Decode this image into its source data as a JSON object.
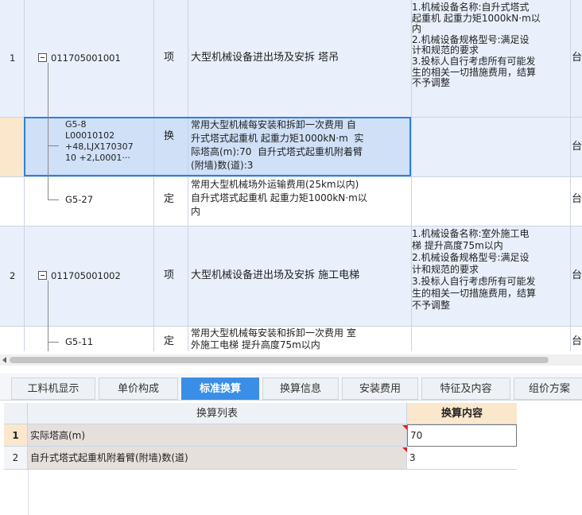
{
  "upper_table": {
    "rows": [
      {
        "index": "1",
        "code": "011705001001",
        "type": "项",
        "name": "大型机械设备进出场及安拆 塔吊",
        "feature": "1.机械设备名称:自升式塔式\n起重机 起重力矩1000kN·m以\n内\n2.机械设备规格型号:满足设\n计和规范的要求\n3.投标人自行考虑所有可能发\n生的相关一切措施费用，结算\n不予调整",
        "unit": "台"
      },
      {
        "index": "",
        "code": "G5-8\nL00010102\n+48,LJX170307\n10 +2,L0001···",
        "type": "换",
        "name": "常用大型机械每安装和拆卸一次费用 自\n升式塔式起重机 起重力矩1000kN·m  实\n际塔高(m):70  自升式塔式起重机附着臂\n(附墙)数(道):3",
        "feature": "",
        "unit": "台"
      },
      {
        "index": "",
        "code": "G5-27",
        "type": "定",
        "name": "常用大型机械场外运输费用(25km以内)\n自升式塔式起重机 起重力矩1000kN·m以\n内",
        "feature": "",
        "unit": "台"
      },
      {
        "index": "2",
        "code": "011705001002",
        "type": "项",
        "name": "大型机械设备进出场及安拆 施工电梯",
        "feature": "1.机械设备名称:室外施工电\n梯 提升高度75m以内\n2.机械设备规格型号:满足设\n计和规范的要求\n3.投标人自行考虑所有可能发\n生的相关一切措施费用，结算\n不予调整",
        "unit": "台"
      },
      {
        "index": "",
        "code": "G5-11",
        "type": "定",
        "name": "常用大型机械每安装和拆卸一次费用 室\n外施工电梯 提升高度75m以内",
        "feature": "",
        "unit": "台"
      }
    ]
  },
  "tabs": [
    {
      "label": "工料机显示",
      "active": false
    },
    {
      "label": "单价构成",
      "active": false
    },
    {
      "label": "标准换算",
      "active": true
    },
    {
      "label": "换算信息",
      "active": false
    },
    {
      "label": "安装费用",
      "active": false
    },
    {
      "label": "特征及内容",
      "active": false
    },
    {
      "label": "组价方案",
      "active": false
    }
  ],
  "lower_table": {
    "headers": {
      "list": "换算列表",
      "content": "换算内容"
    },
    "rows": [
      {
        "index": "1",
        "name": "实际塔高(m)",
        "value": "70"
      },
      {
        "index": "2",
        "name": "自升式塔式起重机附着臂(附墙)数(道)",
        "value": "3"
      }
    ]
  },
  "colors": {
    "accent": "#3a8ee6",
    "row_blue": "#e9f0fb",
    "selected": "#cfe0f7",
    "marker_red": "#e02020"
  }
}
